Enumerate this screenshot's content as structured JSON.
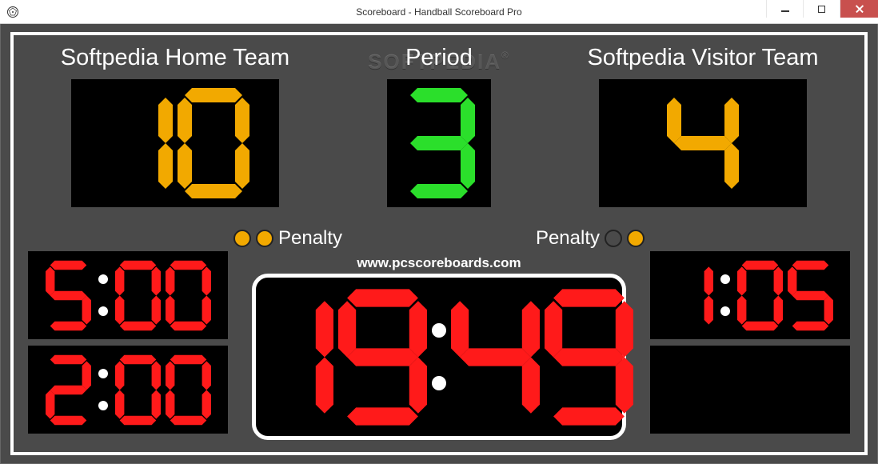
{
  "window": {
    "title": "Scoreboard - Handball Scoreboard Pro"
  },
  "watermark": "SOFTPEDIA",
  "url": "www.pcscoreboards.com",
  "period": {
    "label": "Period",
    "value": "3"
  },
  "penalty_label": "Penalty",
  "home": {
    "name": "Softpedia Home Team",
    "score": "10",
    "penalty_lights": [
      true,
      true
    ],
    "penalty_timers": [
      "5:00",
      "2:00"
    ]
  },
  "visitor": {
    "name": "Softpedia Visitor Team",
    "score": "4",
    "penalty_lights": [
      true,
      false
    ],
    "penalty_timers": [
      "1:05",
      ""
    ]
  },
  "main_clock": "19:49",
  "colors": {
    "score": "#f2a900",
    "period": "#2bdf2b",
    "clock": "#ff1a1a"
  }
}
